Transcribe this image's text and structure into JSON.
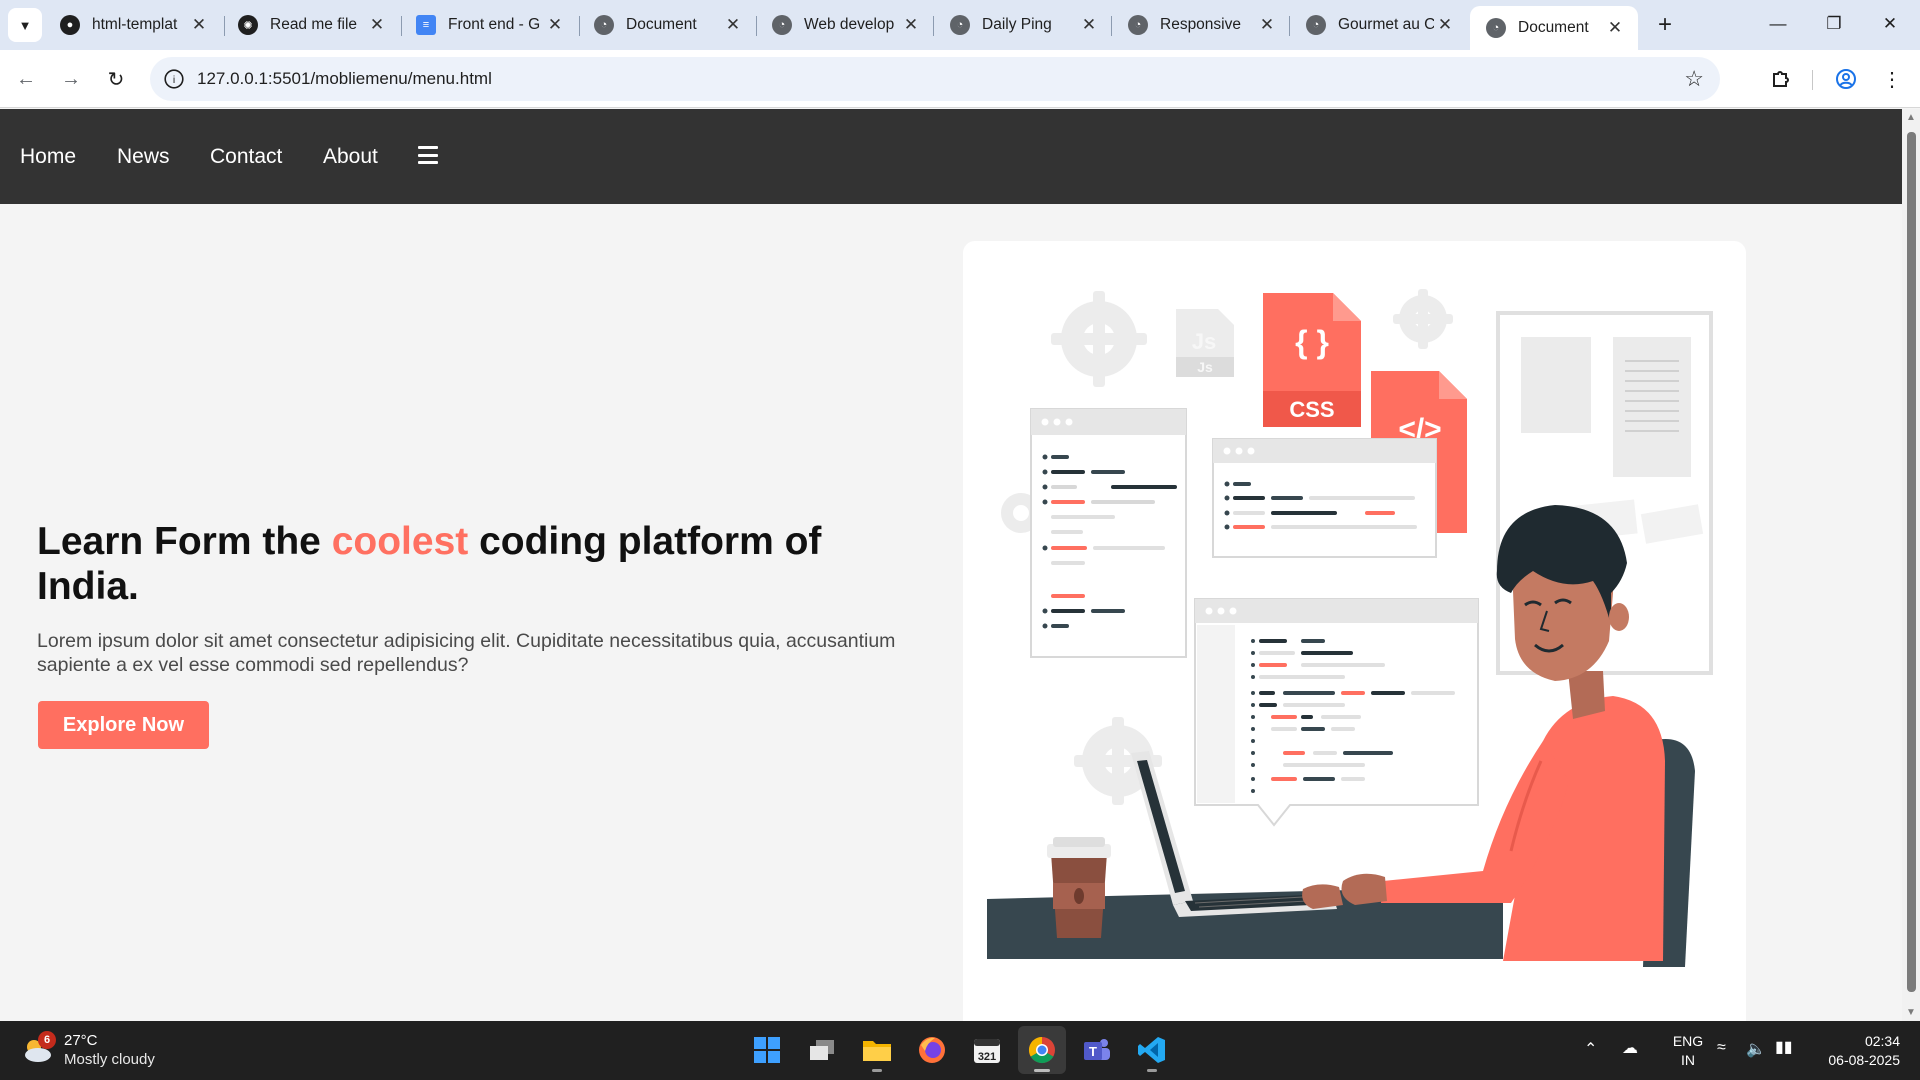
{
  "browser": {
    "tabs": [
      {
        "title": "html-templat",
        "icon": "github-icon"
      },
      {
        "title": "Read me file",
        "icon": "openai-icon"
      },
      {
        "title": "Front end - G",
        "icon": "google-docs-icon"
      },
      {
        "title": "Document",
        "icon": "globe-icon"
      },
      {
        "title": "Web develop",
        "icon": "globe-icon"
      },
      {
        "title": "Daily Ping",
        "icon": "globe-icon"
      },
      {
        "title": "Responsive",
        "icon": "globe-icon"
      },
      {
        "title": "Gourmet au C",
        "icon": "globe-icon"
      },
      {
        "title": "Document",
        "icon": "globe-icon",
        "active": true
      }
    ],
    "url": "127.0.0.1:5501/mobliemenu/menu.html"
  },
  "page": {
    "nav": {
      "links": [
        "Home",
        "News",
        "Contact",
        "About"
      ],
      "menu_icon": "hamburger-menu-icon"
    },
    "hero": {
      "title_before": "Learn Form the ",
      "title_accent": "coolest",
      "title_after": " coding platform of India.",
      "description": "Lorem ipsum dolor sit amet consectetur adipisicing elit. Cupiditate necessitatibus quia, accusantium sapiente a ex vel esse commodi sed repellendus?",
      "button_label": "Explore Now"
    },
    "illustration": {
      "file_labels": [
        "{ }",
        "CSS",
        "</>",
        "Js"
      ],
      "colors": {
        "accent": "#ff6f60",
        "dark": "#37474f",
        "light": "#ebebeb"
      }
    },
    "colors": {
      "navbar": "#333333",
      "accent": "#ff7061",
      "button": "#ff6f60",
      "background": "#f4f4f4"
    }
  },
  "taskbar": {
    "weather": {
      "temp": "27°C",
      "desc": "Mostly cloudy",
      "badge": "6"
    },
    "apps": [
      "start-icon",
      "task-view-icon",
      "file-explorer-icon",
      "firefox-icon",
      "calendar-app-icon",
      "chrome-icon",
      "teams-icon",
      "vscode-icon"
    ],
    "calendar_badge": "321",
    "lang": {
      "line1": "ENG",
      "line2": "IN"
    },
    "clock": {
      "time": "02:34",
      "date": "06-08-2025"
    }
  }
}
